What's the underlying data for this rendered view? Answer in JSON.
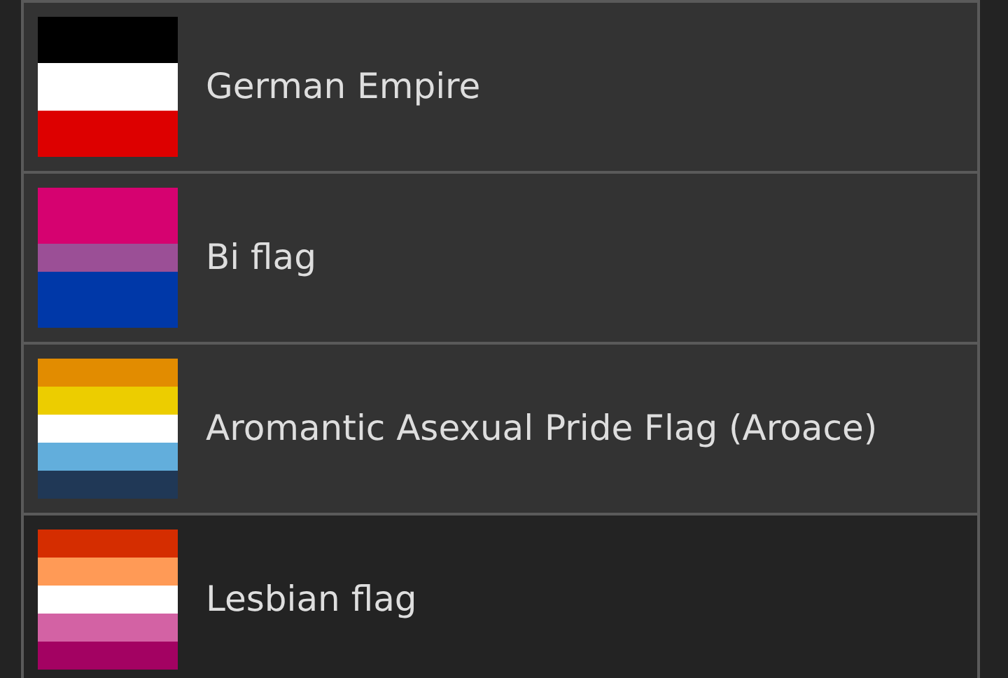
{
  "items": [
    {
      "label": "German Empire",
      "selected": false,
      "stripes": [
        {
          "color": "#000000"
        },
        {
          "color": "#ffffff"
        },
        {
          "color": "#dd0000"
        }
      ]
    },
    {
      "label": "Bi flag",
      "selected": false,
      "stripes": [
        {
          "color": "#d60270"
        },
        {
          "color": "#d60270"
        },
        {
          "color": "#9b4f96"
        },
        {
          "color": "#0038a8"
        },
        {
          "color": "#0038a8"
        }
      ]
    },
    {
      "label": "Aromantic Asexual Pride Flag (Aroace)",
      "selected": false,
      "stripes": [
        {
          "color": "#e28c00"
        },
        {
          "color": "#eccd00"
        },
        {
          "color": "#ffffff"
        },
        {
          "color": "#62aedc"
        },
        {
          "color": "#203856"
        }
      ]
    },
    {
      "label": "Lesbian flag",
      "selected": true,
      "stripes": [
        {
          "color": "#d52d00"
        },
        {
          "color": "#ff9a56"
        },
        {
          "color": "#ffffff"
        },
        {
          "color": "#d362a4"
        },
        {
          "color": "#a30262"
        }
      ]
    }
  ]
}
